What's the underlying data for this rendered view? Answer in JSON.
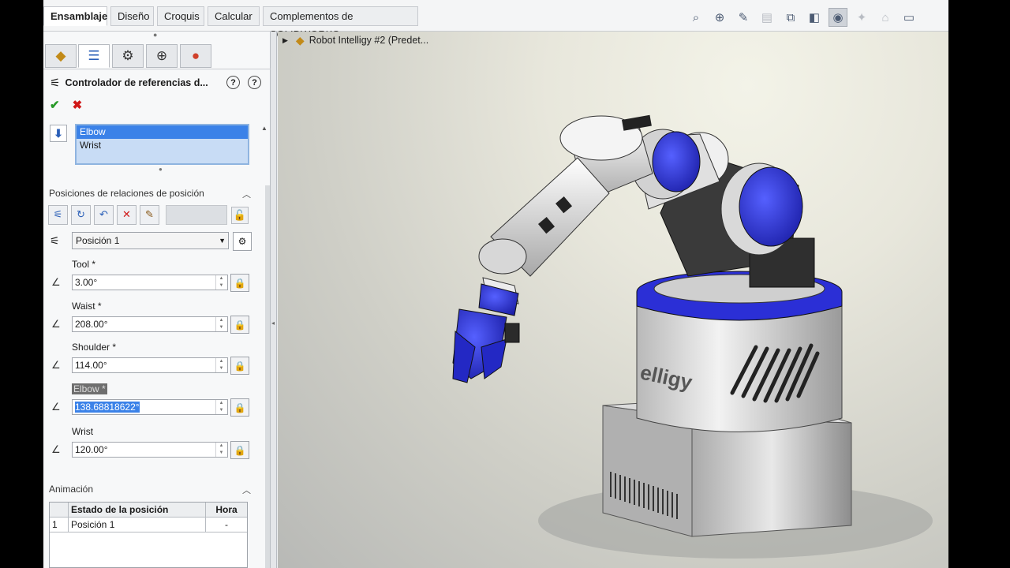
{
  "tabs": [
    "Ensamblaje",
    "Diseño",
    "Croquis",
    "Calcular",
    "Complementos de SOLIDWORKS"
  ],
  "toolbar_icons": [
    "zoom-fit-icon",
    "zoom-area-icon",
    "previous-view-icon",
    "section-view-icon",
    "view-orientation-icon",
    "display-style-icon",
    "hide-show-icon",
    "edit-appearance-icon",
    "apply-scene-icon",
    "view-settings-icon"
  ],
  "panel_tabs": [
    "featuremanager-icon",
    "propertymanager-icon",
    "configurationmanager-icon",
    "dimxpert-icon",
    "displaymanager-icon"
  ],
  "property_manager": {
    "title": "Controlador de referencias d...",
    "help_1": "?",
    "help_2": "?"
  },
  "selection_list": [
    "Elbow",
    "Wrist"
  ],
  "positions_section": {
    "title": "Posiciones de relaciones de posición",
    "current": "Posición 1"
  },
  "fields": [
    {
      "label": "Tool *",
      "value": "3.00°"
    },
    {
      "label": "Waist *",
      "value": "208.00°"
    },
    {
      "label": "Shoulder *",
      "value": "114.00°"
    },
    {
      "label": "Elbow *",
      "value": "138.68818622°"
    },
    {
      "label": "Wrist",
      "value": "120.00°"
    }
  ],
  "animation": {
    "title": "Animación",
    "headers": [
      "",
      "Estado de la posición",
      "Hora"
    ],
    "rows": [
      [
        "1",
        "Posición 1",
        "-"
      ]
    ]
  },
  "viewport": {
    "tree_node": "Robot Intelligy #2  (Predet...",
    "base_logo": "elligy"
  },
  "colors": {
    "accent_blue": "#3b82e8",
    "part_blue": "#2b2fd6",
    "ok_green": "#2a9a2a",
    "cancel_red": "#d01818"
  }
}
